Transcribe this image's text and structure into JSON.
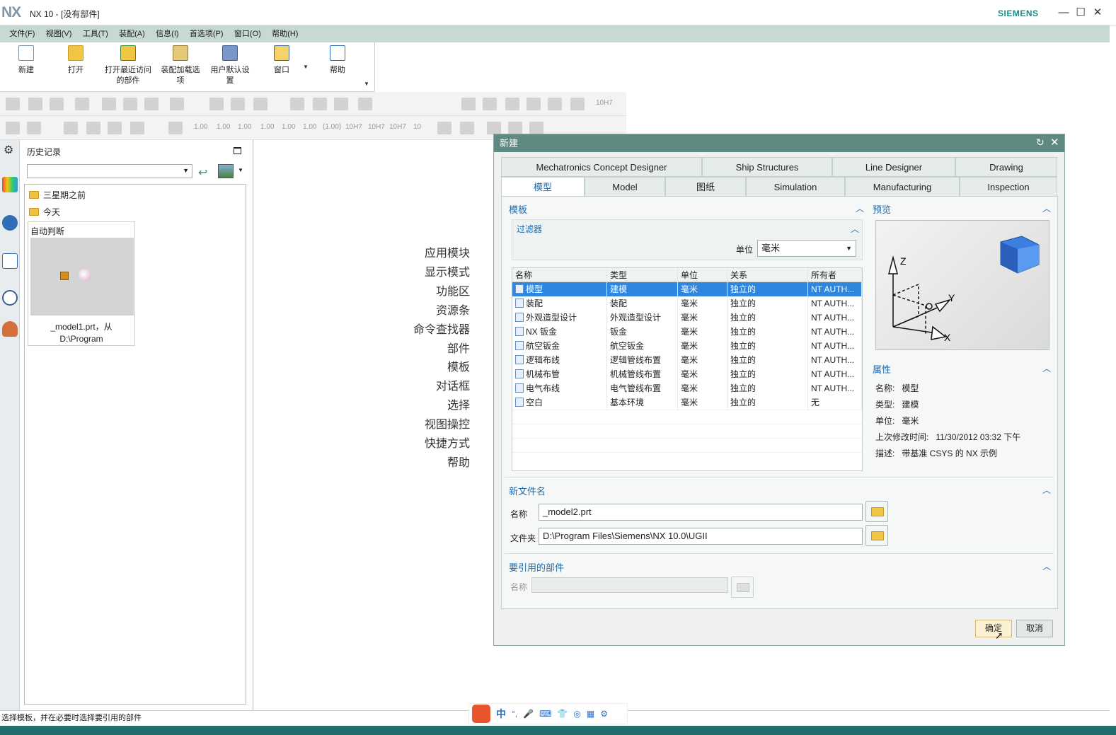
{
  "window": {
    "logo": "NX",
    "title": "NX 10 - [没有部件]",
    "brand": "SIEMENS",
    "controls": [
      "—",
      "☐",
      "✕"
    ]
  },
  "menu": [
    "文件(F)",
    "视图(V)",
    "工具(T)",
    "装配(A)",
    "信息(I)",
    "首选项(P)",
    "窗口(O)",
    "帮助(H)"
  ],
  "ribbon": {
    "new": "新建",
    "open": "打开",
    "recent_line1": "打开最近访问",
    "recent_line2": "的部件",
    "assembly_line1": "装配加载选",
    "assembly_line2": "项",
    "user_line1": "用户默认设",
    "user_line2": "置",
    "window": "窗口",
    "help": "帮助"
  },
  "toolbar_labels": [
    "1.00",
    "1.00",
    "1.00",
    "1.00",
    "1.00",
    "1.00",
    "(1.00)",
    "10H7",
    "10H7",
    "10H7",
    "10",
    "10H7"
  ],
  "history": {
    "title": "历史记录",
    "folder_old": "三星期之前",
    "folder_today": "今天",
    "card_title": "自动判断",
    "card_caption_1": "_model1.prt，从",
    "card_caption_2": "D:\\Program"
  },
  "roles": [
    "应用模块",
    "显示模式",
    "功能区",
    "资源条",
    "命令查找器",
    "部件",
    "模板",
    "对话框",
    "选择",
    "视图操控",
    "快捷方式",
    "帮助"
  ],
  "dialog": {
    "title": "新建",
    "tabs_row1": [
      "Mechatronics Concept Designer",
      "Ship Structures",
      "Line Designer",
      "Drawing"
    ],
    "tabs_row2": [
      "模型",
      "Model",
      "图纸",
      "Simulation",
      "Manufacturing",
      "Inspection"
    ],
    "template_section": "模板",
    "filter_section": "过滤器",
    "unit_label": "单位",
    "unit_value": "毫米",
    "columns": [
      "名称",
      "类型",
      "单位",
      "关系",
      "所有者"
    ],
    "rows": [
      [
        "模型",
        "建模",
        "毫米",
        "独立的",
        "NT AUTH..."
      ],
      [
        "装配",
        "装配",
        "毫米",
        "独立的",
        "NT AUTH..."
      ],
      [
        "外观造型设计",
        "外观造型设计",
        "毫米",
        "独立的",
        "NT AUTH..."
      ],
      [
        "NX 钣金",
        "钣金",
        "毫米",
        "独立的",
        "NT AUTH..."
      ],
      [
        "航空钣金",
        "航空钣金",
        "毫米",
        "独立的",
        "NT AUTH..."
      ],
      [
        "逻辑布线",
        "逻辑管线布置",
        "毫米",
        "独立的",
        "NT AUTH..."
      ],
      [
        "机械布管",
        "机械管线布置",
        "毫米",
        "独立的",
        "NT AUTH..."
      ],
      [
        "电气布线",
        "电气管线布置",
        "毫米",
        "独立的",
        "NT AUTH..."
      ],
      [
        "空白",
        "基本环境",
        "毫米",
        "独立的",
        "无"
      ]
    ],
    "selected_row": 0,
    "preview_section": "预览",
    "axis_labels": [
      "Z",
      "Y",
      "X"
    ],
    "properties_section": "属性",
    "properties": [
      [
        "名称:",
        "模型"
      ],
      [
        "类型:",
        "建模"
      ],
      [
        "单位:",
        "毫米"
      ],
      [
        "上次修改时间:",
        "11/30/2012 03:32 下午"
      ],
      [
        "描述:",
        "带基准 CSYS 的 NX 示例"
      ]
    ],
    "newfile_section": "新文件名",
    "name_label": "名称",
    "name_value": "_model2.prt",
    "folder_label": "文件夹",
    "folder_value": "D:\\Program Files\\Siemens\\NX 10.0\\UGII",
    "ref_section": "要引用的部件",
    "ref_name_label": "名称",
    "ok": "确定",
    "cancel": "取消"
  },
  "status": "选择模板，并在必要时选择要引用的部件",
  "ime": [
    "中",
    "°,",
    "🎤",
    "⌨",
    "👕",
    "◎",
    "▦",
    "⚙"
  ],
  "colors": {
    "menubar": "#c8d9d4",
    "dialog_title": "#5f8a82",
    "selection": "#2e86de",
    "accent_text": "#1a6ab0"
  }
}
